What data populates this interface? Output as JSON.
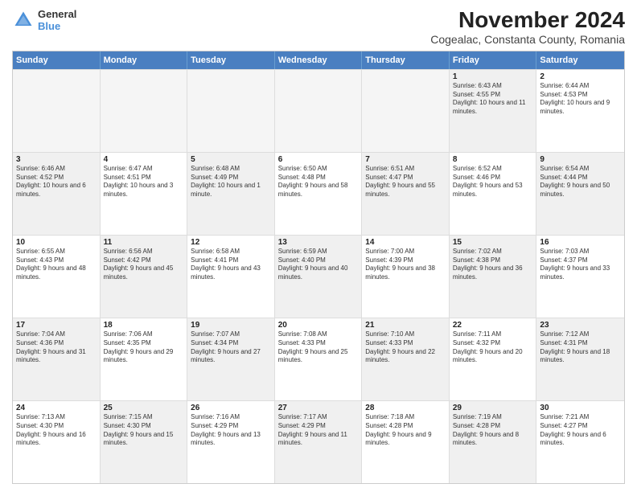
{
  "header": {
    "logo_general": "General",
    "logo_blue": "Blue",
    "title": "November 2024",
    "subtitle": "Cogealac, Constanta County, Romania"
  },
  "weekdays": [
    "Sunday",
    "Monday",
    "Tuesday",
    "Wednesday",
    "Thursday",
    "Friday",
    "Saturday"
  ],
  "rows": [
    [
      {
        "day": "",
        "text": "",
        "empty": true
      },
      {
        "day": "",
        "text": "",
        "empty": true
      },
      {
        "day": "",
        "text": "",
        "empty": true
      },
      {
        "day": "",
        "text": "",
        "empty": true
      },
      {
        "day": "",
        "text": "",
        "empty": true
      },
      {
        "day": "1",
        "text": "Sunrise: 6:43 AM\nSunset: 4:55 PM\nDaylight: 10 hours and 11 minutes.",
        "shaded": true
      },
      {
        "day": "2",
        "text": "Sunrise: 6:44 AM\nSunset: 4:53 PM\nDaylight: 10 hours and 9 minutes.",
        "shaded": false
      }
    ],
    [
      {
        "day": "3",
        "text": "Sunrise: 6:46 AM\nSunset: 4:52 PM\nDaylight: 10 hours and 6 minutes.",
        "shaded": true
      },
      {
        "day": "4",
        "text": "Sunrise: 6:47 AM\nSunset: 4:51 PM\nDaylight: 10 hours and 3 minutes.",
        "shaded": false
      },
      {
        "day": "5",
        "text": "Sunrise: 6:48 AM\nSunset: 4:49 PM\nDaylight: 10 hours and 1 minute.",
        "shaded": true
      },
      {
        "day": "6",
        "text": "Sunrise: 6:50 AM\nSunset: 4:48 PM\nDaylight: 9 hours and 58 minutes.",
        "shaded": false
      },
      {
        "day": "7",
        "text": "Sunrise: 6:51 AM\nSunset: 4:47 PM\nDaylight: 9 hours and 55 minutes.",
        "shaded": true
      },
      {
        "day": "8",
        "text": "Sunrise: 6:52 AM\nSunset: 4:46 PM\nDaylight: 9 hours and 53 minutes.",
        "shaded": false
      },
      {
        "day": "9",
        "text": "Sunrise: 6:54 AM\nSunset: 4:44 PM\nDaylight: 9 hours and 50 minutes.",
        "shaded": true
      }
    ],
    [
      {
        "day": "10",
        "text": "Sunrise: 6:55 AM\nSunset: 4:43 PM\nDaylight: 9 hours and 48 minutes.",
        "shaded": false
      },
      {
        "day": "11",
        "text": "Sunrise: 6:56 AM\nSunset: 4:42 PM\nDaylight: 9 hours and 45 minutes.",
        "shaded": true
      },
      {
        "day": "12",
        "text": "Sunrise: 6:58 AM\nSunset: 4:41 PM\nDaylight: 9 hours and 43 minutes.",
        "shaded": false
      },
      {
        "day": "13",
        "text": "Sunrise: 6:59 AM\nSunset: 4:40 PM\nDaylight: 9 hours and 40 minutes.",
        "shaded": true
      },
      {
        "day": "14",
        "text": "Sunrise: 7:00 AM\nSunset: 4:39 PM\nDaylight: 9 hours and 38 minutes.",
        "shaded": false
      },
      {
        "day": "15",
        "text": "Sunrise: 7:02 AM\nSunset: 4:38 PM\nDaylight: 9 hours and 36 minutes.",
        "shaded": true
      },
      {
        "day": "16",
        "text": "Sunrise: 7:03 AM\nSunset: 4:37 PM\nDaylight: 9 hours and 33 minutes.",
        "shaded": false
      }
    ],
    [
      {
        "day": "17",
        "text": "Sunrise: 7:04 AM\nSunset: 4:36 PM\nDaylight: 9 hours and 31 minutes.",
        "shaded": true
      },
      {
        "day": "18",
        "text": "Sunrise: 7:06 AM\nSunset: 4:35 PM\nDaylight: 9 hours and 29 minutes.",
        "shaded": false
      },
      {
        "day": "19",
        "text": "Sunrise: 7:07 AM\nSunset: 4:34 PM\nDaylight: 9 hours and 27 minutes.",
        "shaded": true
      },
      {
        "day": "20",
        "text": "Sunrise: 7:08 AM\nSunset: 4:33 PM\nDaylight: 9 hours and 25 minutes.",
        "shaded": false
      },
      {
        "day": "21",
        "text": "Sunrise: 7:10 AM\nSunset: 4:33 PM\nDaylight: 9 hours and 22 minutes.",
        "shaded": true
      },
      {
        "day": "22",
        "text": "Sunrise: 7:11 AM\nSunset: 4:32 PM\nDaylight: 9 hours and 20 minutes.",
        "shaded": false
      },
      {
        "day": "23",
        "text": "Sunrise: 7:12 AM\nSunset: 4:31 PM\nDaylight: 9 hours and 18 minutes.",
        "shaded": true
      }
    ],
    [
      {
        "day": "24",
        "text": "Sunrise: 7:13 AM\nSunset: 4:30 PM\nDaylight: 9 hours and 16 minutes.",
        "shaded": false
      },
      {
        "day": "25",
        "text": "Sunrise: 7:15 AM\nSunset: 4:30 PM\nDaylight: 9 hours and 15 minutes.",
        "shaded": true
      },
      {
        "day": "26",
        "text": "Sunrise: 7:16 AM\nSunset: 4:29 PM\nDaylight: 9 hours and 13 minutes.",
        "shaded": false
      },
      {
        "day": "27",
        "text": "Sunrise: 7:17 AM\nSunset: 4:29 PM\nDaylight: 9 hours and 11 minutes.",
        "shaded": true
      },
      {
        "day": "28",
        "text": "Sunrise: 7:18 AM\nSunset: 4:28 PM\nDaylight: 9 hours and 9 minutes.",
        "shaded": false
      },
      {
        "day": "29",
        "text": "Sunrise: 7:19 AM\nSunset: 4:28 PM\nDaylight: 9 hours and 8 minutes.",
        "shaded": true
      },
      {
        "day": "30",
        "text": "Sunrise: 7:21 AM\nSunset: 4:27 PM\nDaylight: 9 hours and 6 minutes.",
        "shaded": false
      }
    ]
  ]
}
